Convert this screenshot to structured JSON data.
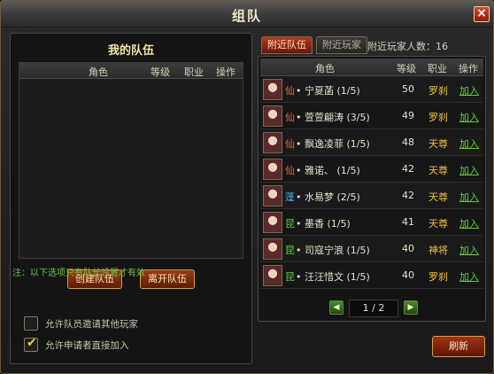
{
  "window": {
    "title": "组队",
    "close_icon": "×"
  },
  "my_team": {
    "title": "我的队伍",
    "columns": [
      "角色",
      "等级",
      "职业",
      "操作"
    ],
    "create_button": "创建队伍",
    "leave_button": "离开队伍",
    "note": "注：以下选项只有队长设置才有效",
    "options": [
      {
        "label": "允许队员邀请其他玩家",
        "checked": false
      },
      {
        "label": "允许申请者直接加入",
        "checked": true
      }
    ]
  },
  "tabs": [
    {
      "label": "附近队伍",
      "active": true
    },
    {
      "label": "附近玩家",
      "active": false
    }
  ],
  "nearby": {
    "count_label": "附近玩家人数：",
    "count": "16"
  },
  "nearby_table": {
    "columns": [
      "角色",
      "等级",
      "职业",
      "操作"
    ],
    "rows": [
      {
        "faction": "仙",
        "faction_color": "#f06a3a",
        "name": "• 宁夏菡 (1/5)",
        "level": "50",
        "job": "罗刹",
        "action": "加入"
      },
      {
        "faction": "仙",
        "faction_color": "#f06a3a",
        "name": "• 萱萱翩涛 (3/5)",
        "level": "49",
        "job": "罗刹",
        "action": "加入"
      },
      {
        "faction": "仙",
        "faction_color": "#f06a3a",
        "name": "• 飘逸凌菲 (1/5)",
        "level": "48",
        "job": "天尊",
        "action": "加入"
      },
      {
        "faction": "仙",
        "faction_color": "#f06a3a",
        "name": "• 雅诺、 (1/5)",
        "level": "42",
        "job": "天尊",
        "action": "加入"
      },
      {
        "faction": "蓬",
        "faction_color": "#4aa8e8",
        "name": "• 水易梦 (2/5)",
        "level": "42",
        "job": "天尊",
        "action": "加入"
      },
      {
        "faction": "昆",
        "faction_color": "#5ed03a",
        "name": "• 墨香 (1/5)",
        "level": "41",
        "job": "天尊",
        "action": "加入"
      },
      {
        "faction": "昆",
        "faction_color": "#5ed03a",
        "name": "• 司寇宁浪 (1/5)",
        "level": "40",
        "job": "神将",
        "action": "加入"
      },
      {
        "faction": "昆",
        "faction_color": "#5ed03a",
        "name": "• 汪汪惜文 (1/5)",
        "level": "40",
        "job": "罗刹",
        "action": "加入"
      }
    ]
  },
  "pager": {
    "text": "1 / 2",
    "prev_icon": "◀",
    "next_icon": "▶"
  },
  "refresh_button": "刷新"
}
